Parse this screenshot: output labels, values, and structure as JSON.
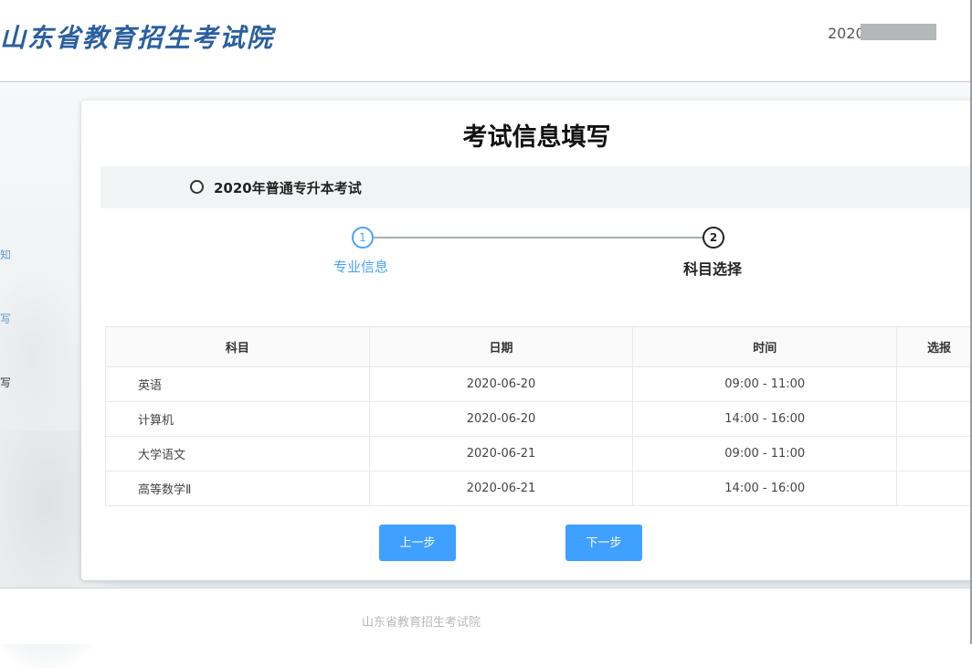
{
  "header": {
    "logo_text": "山东省教育招生考试院",
    "user_id_prefix": "2020"
  },
  "sidebar": {
    "items": [
      {
        "label": "知"
      },
      {
        "label": "写"
      },
      {
        "label": "写"
      }
    ]
  },
  "main": {
    "title": "考试信息填写",
    "exam_option": "2020年普通专升本考试",
    "steps": [
      {
        "number": "1",
        "label": "专业信息",
        "state": "done"
      },
      {
        "number": "2",
        "label": "科目选择",
        "state": "active"
      }
    ],
    "table": {
      "headers": [
        "科目",
        "日期",
        "时间",
        "选报"
      ],
      "rows": [
        {
          "subject": "英语",
          "date": "2020-06-20",
          "time": "09:00 - 11:00"
        },
        {
          "subject": "计算机",
          "date": "2020-06-20",
          "time": "14:00 - 16:00"
        },
        {
          "subject": "大学语文",
          "date": "2020-06-21",
          "time": "09:00 - 11:00"
        },
        {
          "subject": "高等数学Ⅱ",
          "date": "2020-06-21",
          "time": "14:00 - 16:00"
        }
      ]
    },
    "buttons": {
      "prev": "上一步",
      "next": "下一步"
    }
  },
  "footer": {
    "text": "山东省教育招生考试院"
  },
  "colors": {
    "accent": "#3fa0ff",
    "step_active": "#4aa3f5",
    "logo": "#2b5f9e"
  }
}
